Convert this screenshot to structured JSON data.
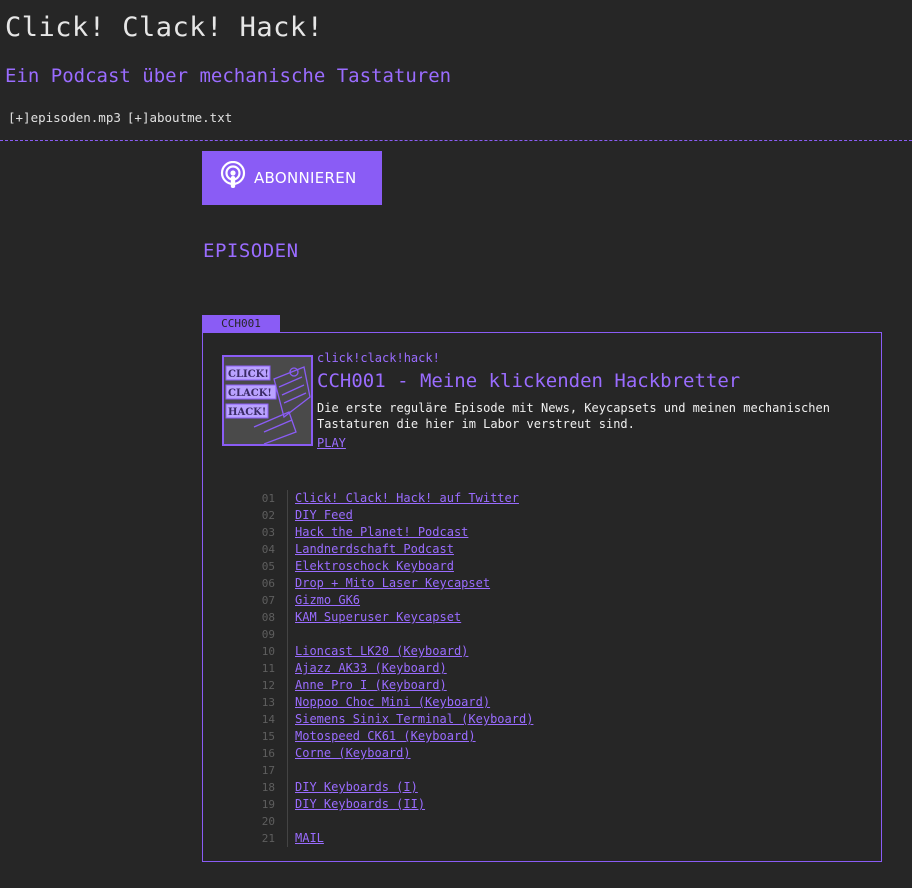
{
  "site": {
    "title": "Click! Clack! Hack!",
    "subtitle": "Ein Podcast über mechanische Tastaturen"
  },
  "nav": {
    "items": [
      {
        "label": "[+]episoden.mp3"
      },
      {
        "label": "[+]aboutme.txt"
      }
    ]
  },
  "subscribe": {
    "label": "ABONNIEREN",
    "icon": "podcast-icon",
    "color": "#8a5cf5"
  },
  "episodes": {
    "heading": "EPISODEN",
    "items": [
      {
        "tab": "CCH001",
        "show": "click!clack!hack!",
        "title": "CCH001 - Meine klickenden Hackbretter",
        "description": "Die erste reguläre Episode mit News, Keycapsets und meinen mechanischen Tastaturen die hier im Labor verstreut sind.",
        "play": "PLAY",
        "cover_words": [
          "CLICK!",
          "CLACK!",
          "HACK!"
        ],
        "links": [
          {
            "num": "01",
            "text": "Click! Clack! Hack! auf Twitter"
          },
          {
            "num": "02",
            "text": "DIY Feed"
          },
          {
            "num": "03",
            "text": "Hack the Planet! Podcast"
          },
          {
            "num": "04",
            "text": "Landnerdschaft Podcast"
          },
          {
            "num": "05",
            "text": "Elektroschock Keyboard"
          },
          {
            "num": "06",
            "text": "Drop + Mito Laser Keycapset"
          },
          {
            "num": "07",
            "text": "Gizmo GK6"
          },
          {
            "num": "08",
            "text": "KAM Superuser Keycapset"
          },
          {
            "num": "09",
            "text": ""
          },
          {
            "num": "10",
            "text": "Lioncast LK20 (Keyboard)"
          },
          {
            "num": "11",
            "text": "Ajazz AK33 (Keyboard)"
          },
          {
            "num": "12",
            "text": "Anne Pro I (Keyboard)"
          },
          {
            "num": "13",
            "text": "Noppoo Choc Mini (Keyboard)"
          },
          {
            "num": "14",
            "text": "Siemens Sinix Terminal (Keyboard)"
          },
          {
            "num": "15",
            "text": "Motospeed CK61 (Keyboard)"
          },
          {
            "num": "16",
            "text": "Corne (Keyboard)"
          },
          {
            "num": "17",
            "text": ""
          },
          {
            "num": "18",
            "text": "DIY Keyboards (I)"
          },
          {
            "num": "19",
            "text": "DIY Keyboards (II)"
          },
          {
            "num": "20",
            "text": ""
          },
          {
            "num": "21",
            "text": "MAIL"
          }
        ]
      }
    ]
  },
  "colors": {
    "accent": "#8a5cf5",
    "background": "#262626",
    "text": "#e8e8e8"
  }
}
